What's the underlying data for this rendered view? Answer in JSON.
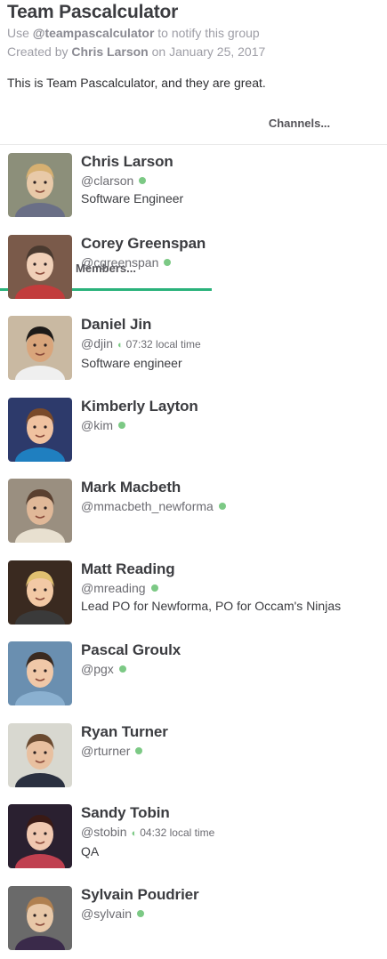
{
  "group": {
    "title": "Team Pascalculator",
    "notify_prefix": "Use",
    "notify_handle": "@teampascalculator",
    "notify_suffix": "to notify this group",
    "created_prefix": "Created by",
    "created_by": "Chris Larson",
    "created_on": "on January 25, 2017",
    "purpose": "This is Team Pascalculator, and they are great."
  },
  "tabs": {
    "members": "Members...",
    "channels": "Channels..."
  },
  "colors": {
    "presence_active": "#7cc985",
    "tab_underline": "#2ab27b"
  },
  "members": [
    {
      "name": "Chris Larson",
      "handle": "@clarson",
      "local_time": "",
      "role": "Software Engineer",
      "avatar": "child-portrait"
    },
    {
      "name": "Corey Greenspan",
      "handle": "@cgreenspan",
      "local_time": "",
      "role": "",
      "avatar": "child-thumbs-up"
    },
    {
      "name": "Daniel Jin",
      "handle": "@djin",
      "local_time": "07:32 local time",
      "role": "Software engineer",
      "avatar": "child-portrait"
    },
    {
      "name": "Kimberly Layton",
      "handle": "@kim",
      "local_time": "",
      "role": "",
      "avatar": "child-tongue-out"
    },
    {
      "name": "Mark Macbeth",
      "handle": "@mmacbeth_newforma",
      "local_time": "",
      "role": "",
      "avatar": "man-sunglasses"
    },
    {
      "name": "Matt Reading",
      "handle": "@mreading",
      "local_time": "",
      "role": "Lead PO for Newforma, PO for Occam's Ninjas",
      "avatar": "child-blond"
    },
    {
      "name": "Pascal Groulx",
      "handle": "@pgx",
      "local_time": "",
      "role": "",
      "avatar": "child-school-photo"
    },
    {
      "name": "Ryan Turner",
      "handle": "@rturner",
      "local_time": "",
      "role": "",
      "avatar": "child-arms-up"
    },
    {
      "name": "Sandy Tobin",
      "handle": "@stobin",
      "local_time": "04:32 local time",
      "role": "QA",
      "avatar": "woman-portrait"
    },
    {
      "name": "Sylvain Poudrier",
      "handle": "@sylvain",
      "local_time": "",
      "role": "",
      "avatar": "child-bowtie"
    }
  ]
}
